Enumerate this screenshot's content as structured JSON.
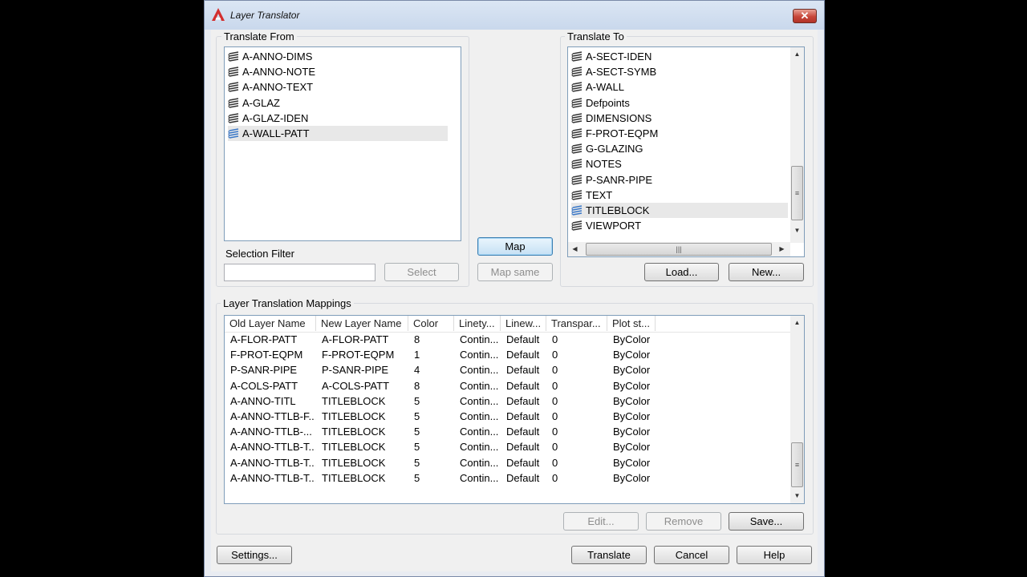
{
  "window": {
    "title": "Layer Translator",
    "close_glyph": "✕"
  },
  "translate_from": {
    "label": "Translate From",
    "layers": [
      "A-ANNO-DIMS",
      "A-ANNO-NOTE",
      "A-ANNO-TEXT",
      "A-GLAZ",
      "A-GLAZ-IDEN",
      "A-WALL-PATT"
    ],
    "selected_index": 5,
    "selection_filter_label": "Selection Filter",
    "selection_filter_value": "",
    "select_button": "Select"
  },
  "middle": {
    "map_button": "Map",
    "map_same_button": "Map same"
  },
  "translate_to": {
    "label": "Translate To",
    "layers": [
      "A-SECT-IDEN",
      "A-SECT-SYMB",
      "A-WALL",
      "Defpoints",
      "DIMENSIONS",
      "F-PROT-EQPM",
      "G-GLAZING",
      "NOTES",
      "P-SANR-PIPE",
      "TEXT",
      "TITLEBLOCK",
      "VIEWPORT"
    ],
    "selected_index": 10,
    "load_button": "Load...",
    "new_button": "New..."
  },
  "mappings": {
    "label": "Layer Translation Mappings",
    "columns": [
      "Old Layer Name",
      "New Layer Name",
      "Color",
      "Linety...",
      "Linew...",
      "Transpar...",
      "Plot st..."
    ],
    "rows": [
      [
        "A-FLOR-PATT",
        "A-FLOR-PATT",
        "8",
        "Contin...",
        "Default",
        "0",
        "ByColor"
      ],
      [
        "F-PROT-EQPM",
        "F-PROT-EQPM",
        "1",
        "Contin...",
        "Default",
        "0",
        "ByColor"
      ],
      [
        "P-SANR-PIPE",
        "P-SANR-PIPE",
        "4",
        "Contin...",
        "Default",
        "0",
        "ByColor"
      ],
      [
        "A-COLS-PATT",
        "A-COLS-PATT",
        "8",
        "Contin...",
        "Default",
        "0",
        "ByColor"
      ],
      [
        "A-ANNO-TITL",
        "TITLEBLOCK",
        "5",
        "Contin...",
        "Default",
        "0",
        "ByColor"
      ],
      [
        "A-ANNO-TTLB-F...",
        "TITLEBLOCK",
        "5",
        "Contin...",
        "Default",
        "0",
        "ByColor"
      ],
      [
        "A-ANNO-TTLB-...",
        "TITLEBLOCK",
        "5",
        "Contin...",
        "Default",
        "0",
        "ByColor"
      ],
      [
        "A-ANNO-TTLB-T...",
        "TITLEBLOCK",
        "5",
        "Contin...",
        "Default",
        "0",
        "ByColor"
      ],
      [
        "A-ANNO-TTLB-T...",
        "TITLEBLOCK",
        "5",
        "Contin...",
        "Default",
        "0",
        "ByColor"
      ],
      [
        "A-ANNO-TTLB-T...",
        "TITLEBLOCK",
        "5",
        "Contin...",
        "Default",
        "0",
        "ByColor"
      ]
    ],
    "edit_button": "Edit...",
    "remove_button": "Remove",
    "save_button": "Save..."
  },
  "footer": {
    "settings_button": "Settings...",
    "translate_button": "Translate",
    "cancel_button": "Cancel",
    "help_button": "Help"
  },
  "icons": {
    "layer": "layer-stack-icon",
    "app": "autocad-logo-icon"
  },
  "colors": {
    "accent": "#3c7fb1",
    "close": "#c7463a",
    "logo": "#d32f2f",
    "layer_selected": "#3a78c8"
  }
}
